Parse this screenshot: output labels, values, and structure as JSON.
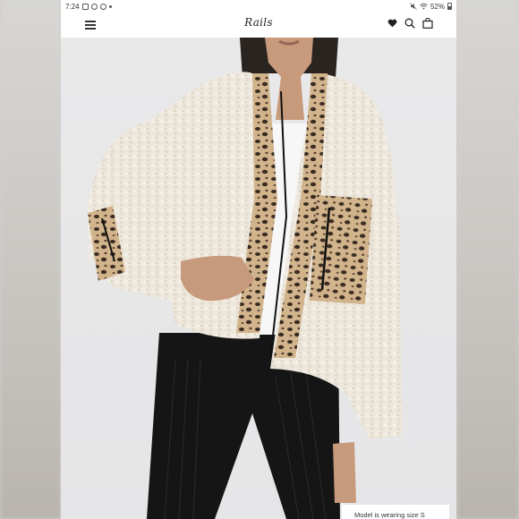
{
  "status_bar": {
    "time": "7:24",
    "battery": "52%",
    "left_icons": [
      "gallery-icon",
      "link-icon",
      "link-icon",
      "dot-icon"
    ],
    "right_icons": [
      "mute-icon",
      "wifi-icon",
      "battery-icon"
    ]
  },
  "header": {
    "logo": "Rails",
    "icons": [
      "menu-icon",
      "heart-icon",
      "search-icon",
      "bag-icon"
    ]
  },
  "product": {
    "caption": "Model is wearing size S"
  }
}
